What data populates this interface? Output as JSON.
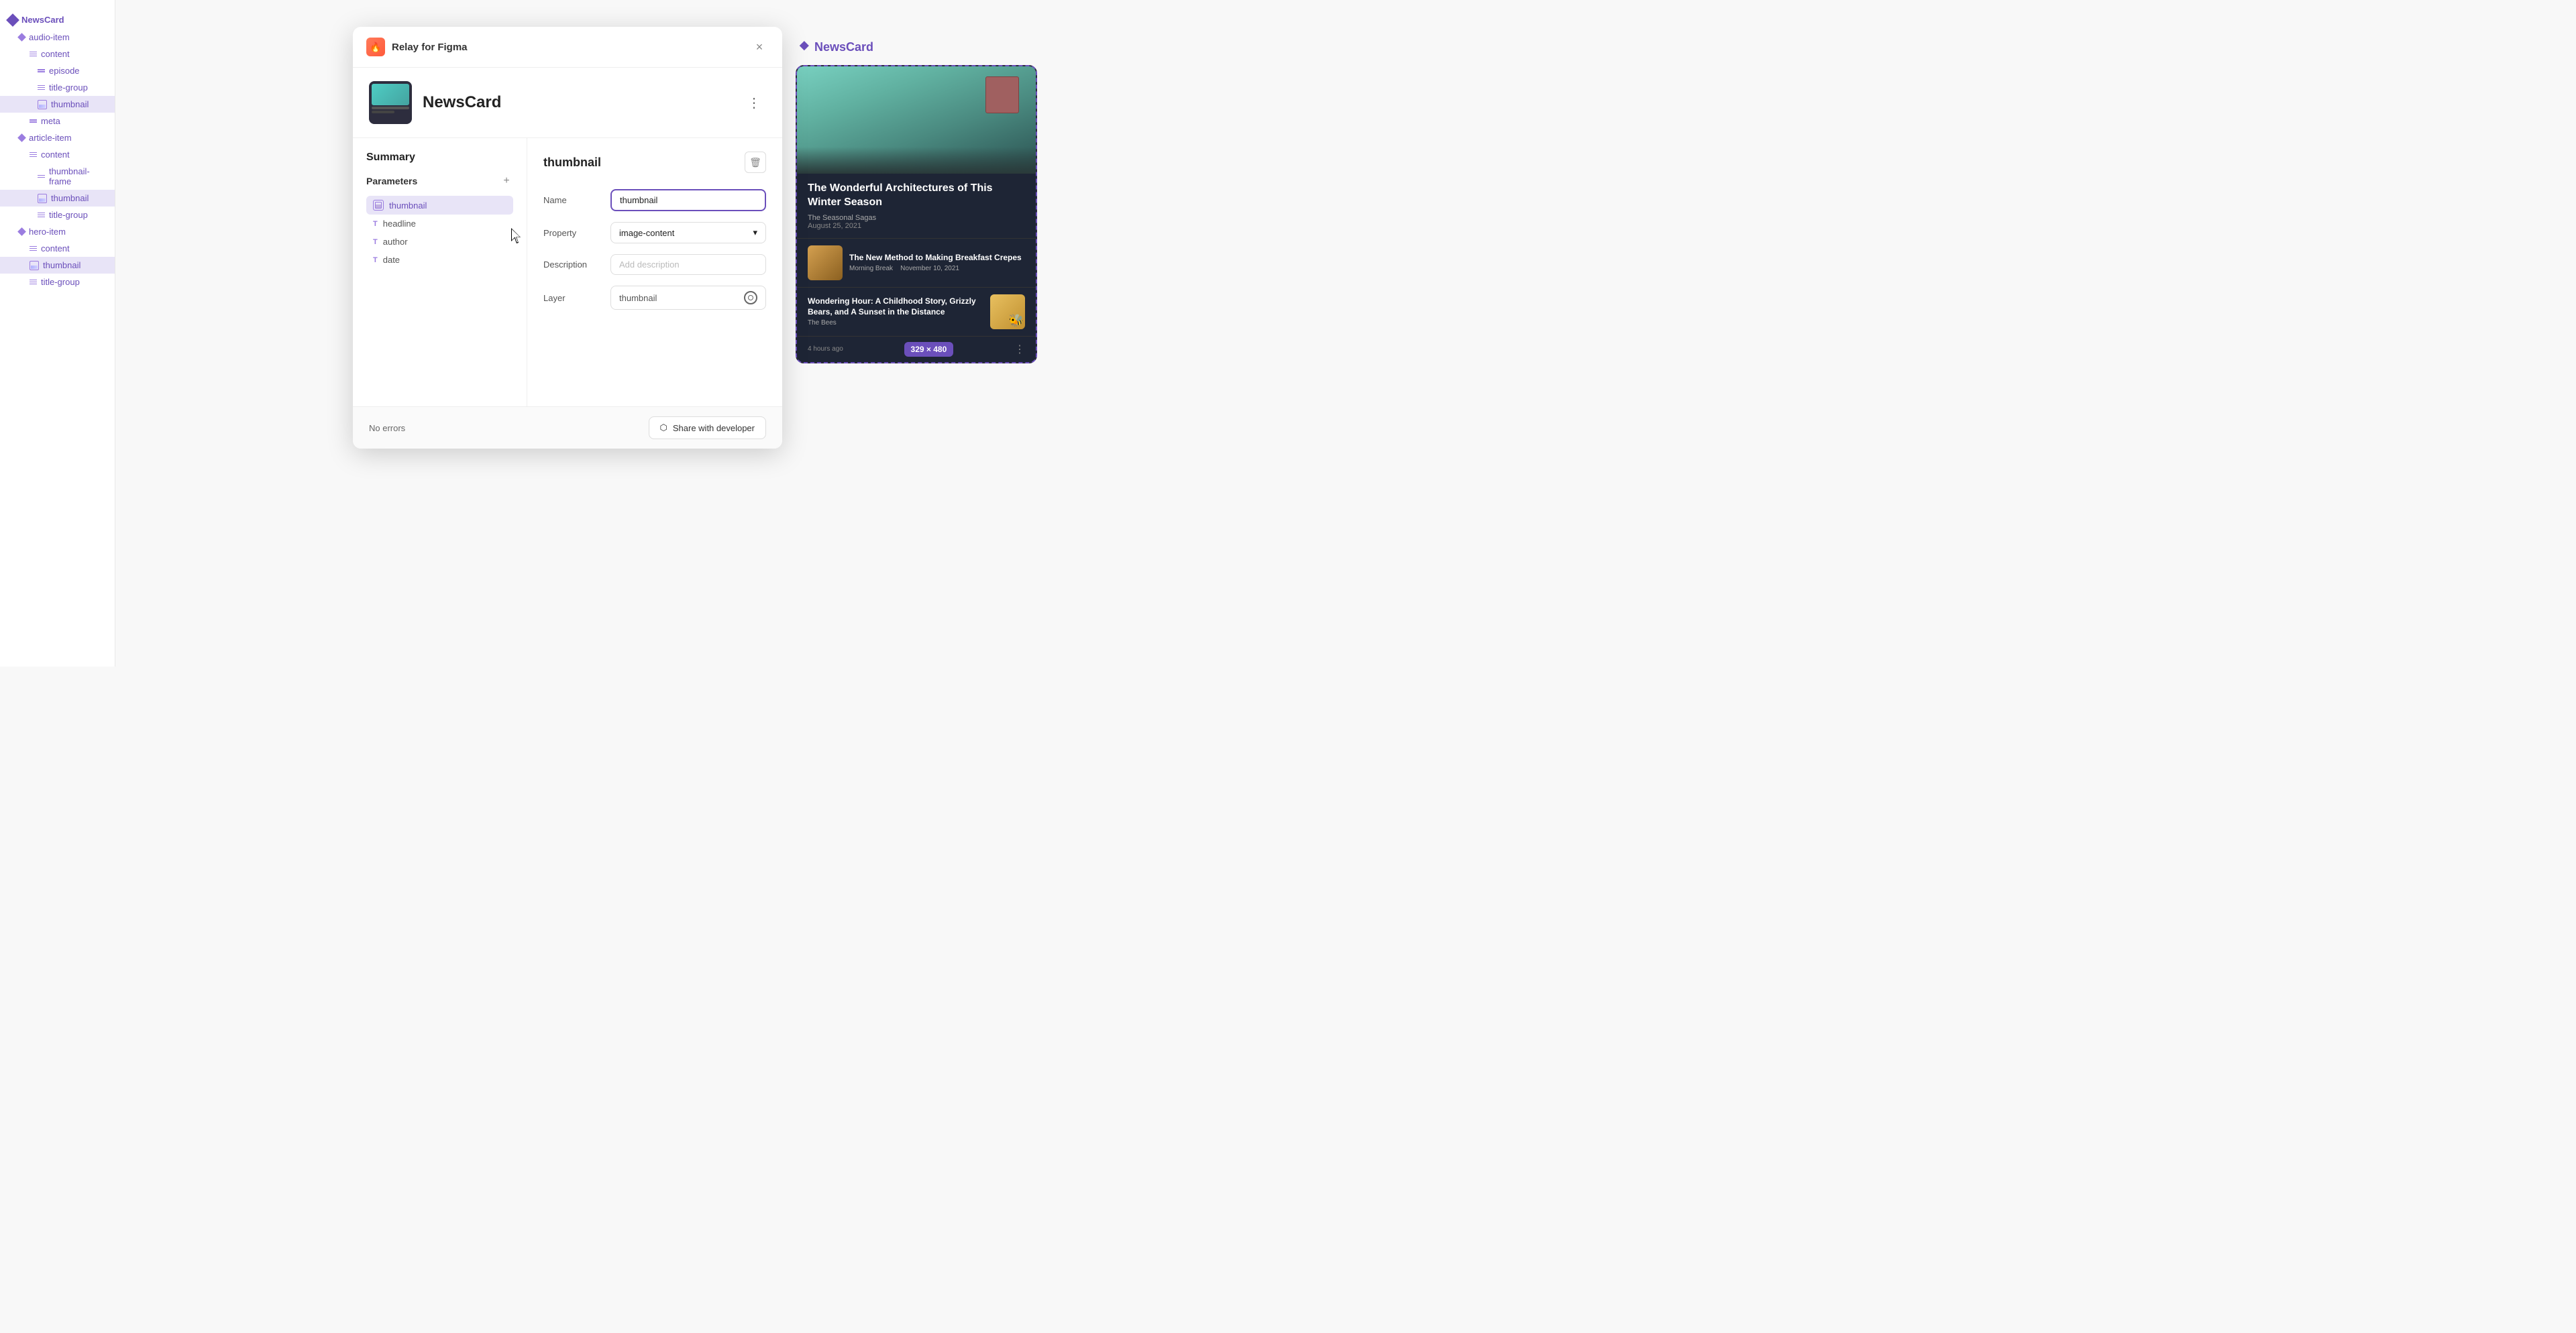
{
  "sidebar": {
    "root_label": "NewsCard",
    "items": [
      {
        "id": "audio-item",
        "label": "audio-item",
        "level": 1,
        "type": "diamond"
      },
      {
        "id": "content",
        "label": "content",
        "level": 2,
        "type": "lines"
      },
      {
        "id": "episode",
        "label": "episode",
        "level": 3,
        "type": "grid"
      },
      {
        "id": "title-group",
        "label": "title-group",
        "level": 3,
        "type": "lines"
      },
      {
        "id": "thumbnail-1",
        "label": "thumbnail",
        "level": 3,
        "type": "img",
        "active": true
      },
      {
        "id": "meta",
        "label": "meta",
        "level": 2,
        "type": "grid"
      },
      {
        "id": "article-item",
        "label": "article-item",
        "level": 1,
        "type": "diamond"
      },
      {
        "id": "content-2",
        "label": "content",
        "level": 2,
        "type": "lines"
      },
      {
        "id": "thumbnail-frame",
        "label": "thumbnail-frame",
        "level": 3,
        "type": "grid"
      },
      {
        "id": "thumbnail-2",
        "label": "thumbnail",
        "level": 3,
        "type": "img",
        "active": true
      },
      {
        "id": "title-group-2",
        "label": "title-group",
        "level": 3,
        "type": "lines"
      },
      {
        "id": "hero-item",
        "label": "hero-item",
        "level": 1,
        "type": "diamond"
      },
      {
        "id": "content-3",
        "label": "content",
        "level": 2,
        "type": "lines"
      },
      {
        "id": "thumbnail-3",
        "label": "thumbnail",
        "level": 2,
        "type": "img",
        "active": true
      },
      {
        "id": "title-group-3",
        "label": "title-group",
        "level": 2,
        "type": "lines"
      }
    ]
  },
  "modal": {
    "relay_label": "Relay for Figma",
    "close_label": "×",
    "component_name": "NewsCard",
    "more_label": "⋮",
    "summary_label": "Summary",
    "parameters_label": "Parameters",
    "add_label": "+",
    "params": [
      {
        "id": "thumbnail",
        "label": "thumbnail",
        "type": "img",
        "active": true
      },
      {
        "id": "headline",
        "label": "headline",
        "type": "text"
      },
      {
        "id": "author",
        "label": "author",
        "type": "text"
      },
      {
        "id": "date",
        "label": "date",
        "type": "text"
      }
    ],
    "detail": {
      "param_name": "thumbnail",
      "delete_label": "🗑",
      "name_label": "Name",
      "name_value": "thumbnail",
      "property_label": "Property",
      "property_value": "image-content",
      "description_label": "Description",
      "description_placeholder": "Add description",
      "layer_label": "Layer",
      "layer_value": "thumbnail"
    },
    "footer": {
      "no_errors": "No errors",
      "share_label": "Share with developer"
    }
  },
  "right_panel": {
    "title": "NewsCard",
    "hero": {
      "headline": "The Wonderful Architectures of This Winter Season",
      "source": "The Seasonal Sagas",
      "date": "August 25, 2021"
    },
    "card1": {
      "headline": "The New Method to Making Breakfast Crepes",
      "source": "Morning Break",
      "date": "November 10, 2021"
    },
    "card2": {
      "headline": "Wondering Hour: A Childhood Story, Grizzly Bears, and A Sunset in the Distance",
      "source": "The Bees",
      "time": "4 hours ago"
    },
    "size_badge": "329 × 480",
    "more_label": "⋮"
  },
  "icons": {
    "relay": "🔥",
    "share": "⬡",
    "target": "⊕"
  }
}
